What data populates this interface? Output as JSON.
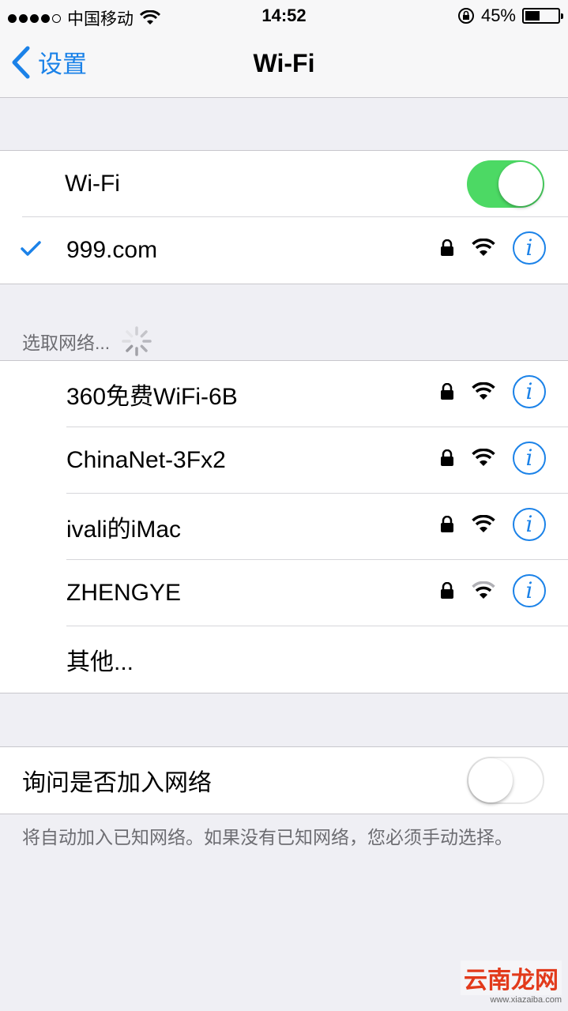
{
  "status_bar": {
    "carrier": "中国移动",
    "time": "14:52",
    "battery_text": "45%",
    "battery_level": 0.45
  },
  "nav": {
    "back_label": "设置",
    "title": "Wi-Fi"
  },
  "wifi_group": {
    "toggle_label": "Wi-Fi",
    "toggle_on": true,
    "connected_network": "999.com"
  },
  "networks_section": {
    "header": "选取网络...",
    "networks": [
      {
        "name": "360免费WiFi-6B"
      },
      {
        "name": "ChinaNet-3Fx2"
      },
      {
        "name": "ivali的iMac"
      },
      {
        "name": "ZHENGYE"
      }
    ],
    "other_label": "其他..."
  },
  "ask_group": {
    "label": "询问是否加入网络",
    "toggle_on": false,
    "footer_note": "将自动加入已知网络。如果没有已知网络，您必须手动选择。"
  },
  "watermark": {
    "brand": "云南龙网",
    "url": "www.xiazaiba.com"
  },
  "colors": {
    "accent": "#1b82e8",
    "toggle_on": "#4cd964",
    "background": "#efeff4"
  }
}
